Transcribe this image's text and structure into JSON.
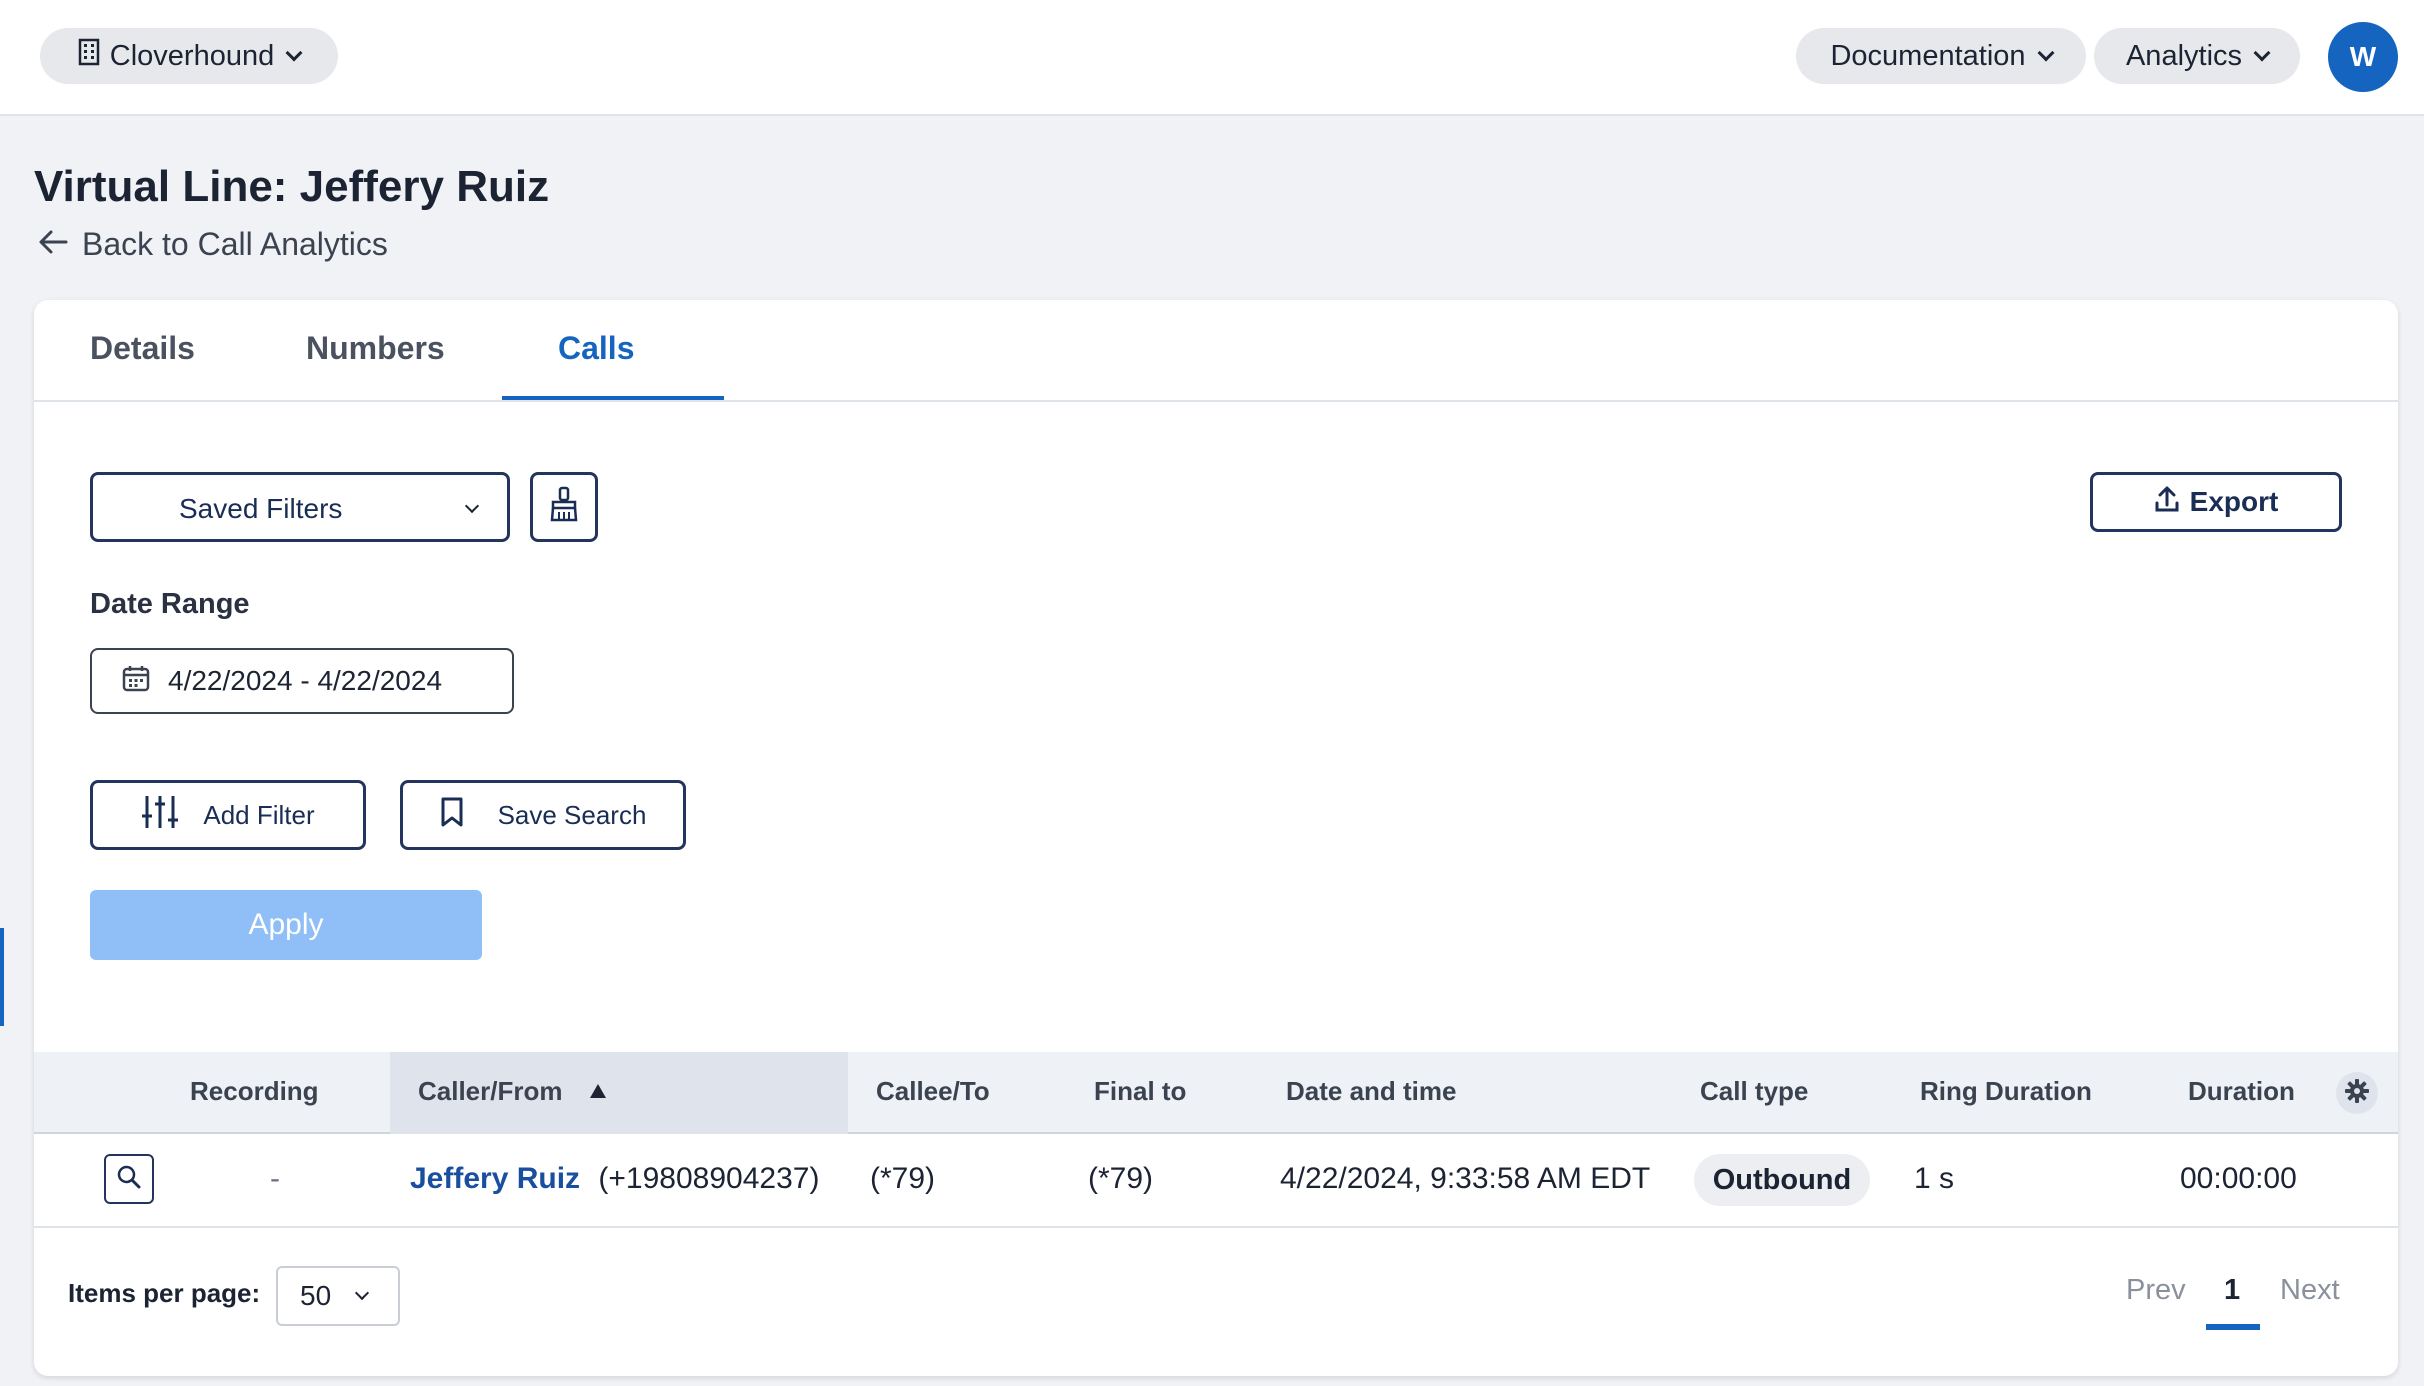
{
  "topbar": {
    "org_name": "Cloverhound",
    "documentation_label": "Documentation",
    "analytics_label": "Analytics",
    "avatar_initial": "W"
  },
  "header": {
    "title": "Virtual Line: Jeffery Ruiz",
    "back_label": "Back to Call Analytics"
  },
  "tabs": [
    {
      "label": "Details"
    },
    {
      "label": "Numbers"
    },
    {
      "label": "Calls"
    }
  ],
  "active_tab": "Calls",
  "filters": {
    "saved_filters_label": "Saved Filters",
    "date_range_label": "Date Range",
    "date_range_value": "4/22/2024 - 4/22/2024",
    "add_filter_label": "Add Filter",
    "save_search_label": "Save Search",
    "apply_label": "Apply",
    "export_label": "Export"
  },
  "table": {
    "columns": [
      "Recording",
      "Caller/From",
      "Callee/To",
      "Final to",
      "Date and time",
      "Call type",
      "Ring Duration",
      "Duration"
    ],
    "sorted_column": "Caller/From",
    "rows": [
      {
        "recording": "-",
        "caller_name": "Jeffery Ruiz",
        "caller_number": "(+19808904237)",
        "callee": "(*79)",
        "final_to": "(*79)",
        "date_time": "4/22/2024, 9:33:58 AM EDT",
        "call_type": "Outbound",
        "ring_duration": "1 s",
        "duration": "00:00:00"
      }
    ]
  },
  "pagination": {
    "items_per_page_label": "Items per page:",
    "items_per_page_value": "50",
    "prev_label": "Prev",
    "current_page": "1",
    "next_label": "Next"
  },
  "colors": {
    "accent": "#1565c0",
    "apply_disabled": "#90bff7",
    "outline": "#23355e"
  }
}
